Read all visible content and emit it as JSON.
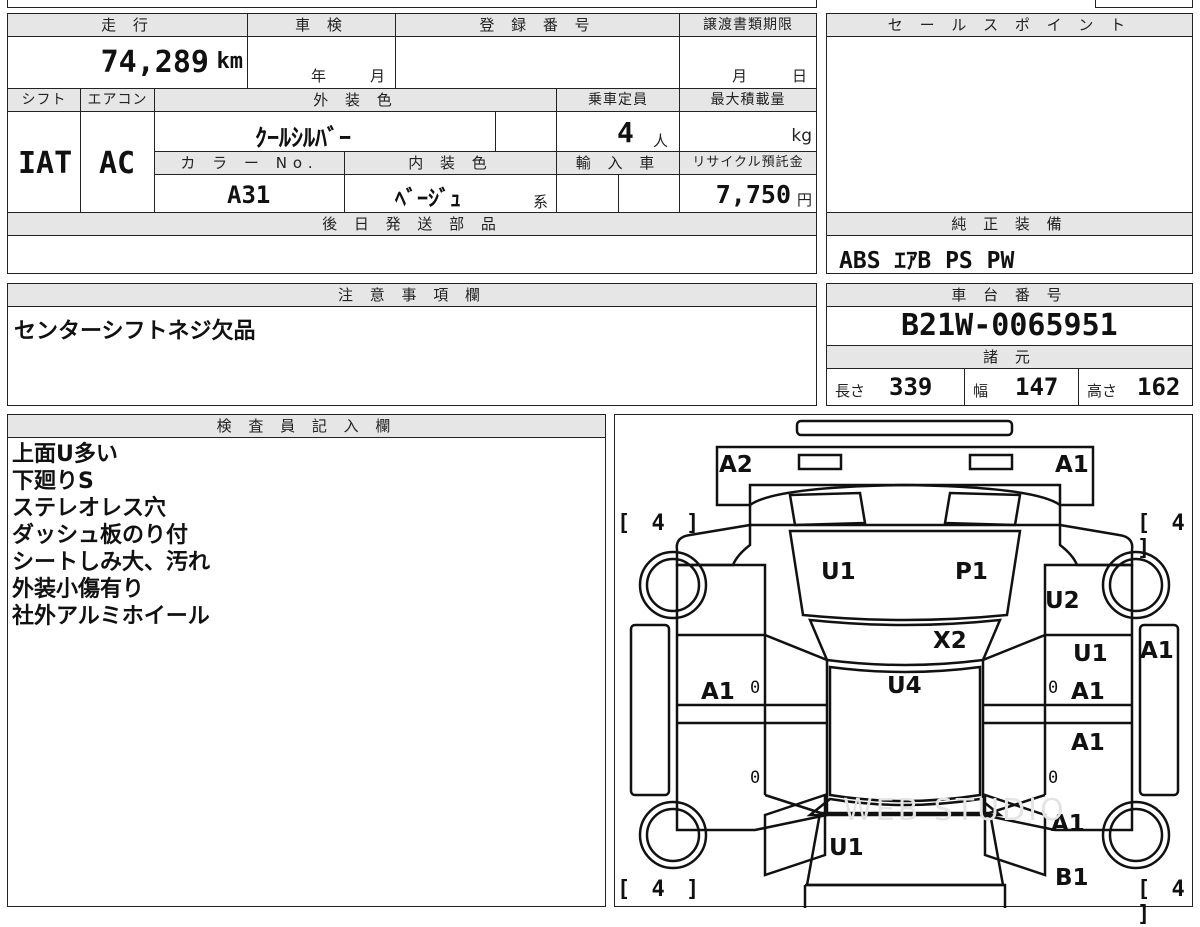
{
  "mileage": {
    "header": "走 行",
    "value": "74,289",
    "unit": "km"
  },
  "inspection": {
    "header": "車 検",
    "year_label": "年",
    "month_label": "月"
  },
  "registration": {
    "header": "登 録 番 号",
    "value": ""
  },
  "transfer_deadline": {
    "header": "譲渡書類期限",
    "month_label": "月",
    "day_label": "日"
  },
  "sales_point": {
    "header": "セ ー ル ス ポ イ ン ト",
    "value": ""
  },
  "shift": {
    "header": "シフト",
    "value": "IAT"
  },
  "aircon": {
    "header": "エアコン",
    "value": "AC"
  },
  "exterior_color": {
    "header": "外 装 色",
    "value": "ｸｰﾙｼﾙﾊﾞｰ"
  },
  "capacity": {
    "header": "乗車定員",
    "value": "4",
    "unit": "人"
  },
  "max_load": {
    "header": "最大積載量",
    "value": "",
    "unit": "kg"
  },
  "color_no": {
    "header": "カ ラ ー No.",
    "value": "A31"
  },
  "interior_color": {
    "header": "内 装 色",
    "value": "ﾍﾞｰｼﾞｭ",
    "suffix": "系"
  },
  "import": {
    "header": "輸 入 車",
    "value": ""
  },
  "recycle_fee": {
    "header": "リサイクル預託金",
    "value": "7,750",
    "unit": "円"
  },
  "later_parts": {
    "header": "後 日 発 送 部 品",
    "value": ""
  },
  "genuine_equipment": {
    "header": "純 正 装 備",
    "value": "ABS ｴｱB PS PW"
  },
  "notes": {
    "header": "注 意 事 項 欄",
    "value": "センターシフトネジ欠品"
  },
  "chassis": {
    "header": "車 台 番 号",
    "value": "B21W-0065951"
  },
  "specs": {
    "header": "諸 元",
    "length_label": "長さ",
    "length": "339",
    "width_label": "幅",
    "width": "147",
    "height_label": "高さ",
    "height": "162"
  },
  "inspector": {
    "header": "検 査 員 記 入 欄",
    "lines": [
      "上面U多い",
      "下廻りS",
      "ステレオレス穴",
      "ダッシュ板のり付",
      "シートしみ大、汚れ",
      "外装小傷有り",
      "社外アルミホイール"
    ]
  },
  "diagram": {
    "tire_fl": "[ 4 ]",
    "tire_fr": "[ 4 ]",
    "tire_rl": "[ 4 ]",
    "tire_rr": "[ 4 ]",
    "marks": {
      "front_left_corner": "A2",
      "front_right_corner": "A1",
      "hood_left": "U1",
      "hood_right": "P1",
      "right_fender": "U2",
      "windshield": "X2",
      "roof": "U4",
      "right_front_door_top": "U1",
      "right_pillar": "A1",
      "left_front_door": "A1",
      "right_front_door": "A1",
      "right_rear_door": "A1",
      "right_rear_quarter": "A1",
      "rear_gate": "U1",
      "rear_right_bumper": "B1"
    },
    "zero_labels": [
      "0",
      "0",
      "0",
      "0"
    ],
    "watermark": "WEB STUDIO"
  }
}
